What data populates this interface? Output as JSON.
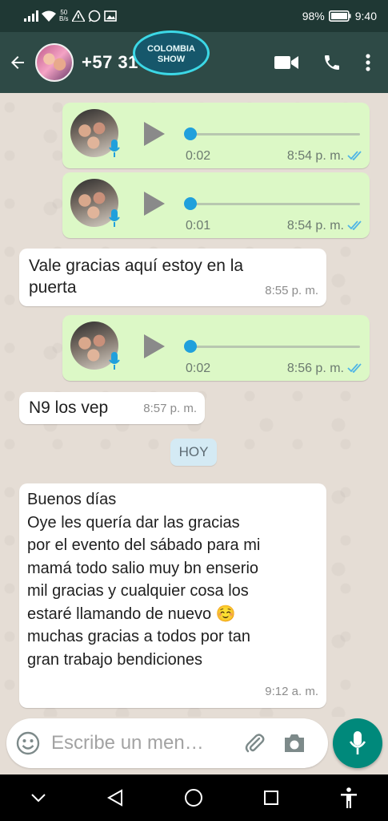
{
  "status_bar": {
    "net_speed_top": "50",
    "net_speed_bottom": "B/s",
    "battery": "98%",
    "time": "9:40"
  },
  "header": {
    "contact_name": "+57 31 55",
    "watermark": {
      "line1": "COLOMBIA",
      "line2": "SHOW"
    }
  },
  "messages": [
    {
      "type": "voice",
      "direction": "outgoing",
      "duration": "0:02",
      "time": "8:54 p. m.",
      "status": "read"
    },
    {
      "type": "voice",
      "direction": "outgoing",
      "duration": "0:01",
      "time": "8:54 p. m.",
      "status": "read"
    },
    {
      "type": "text",
      "direction": "incoming",
      "lines": [
        "Vale gracias aquí estoy en la",
        "puerta"
      ],
      "time": "8:55 p. m."
    },
    {
      "type": "voice",
      "direction": "outgoing",
      "duration": "0:02",
      "time": "8:56 p. m.",
      "status": "read"
    },
    {
      "type": "text",
      "direction": "incoming",
      "lines": [
        "N9 los vep"
      ],
      "time": "8:57 p. m."
    },
    {
      "type": "text",
      "direction": "incoming",
      "lines": [
        "Buenos días",
        "Oye les quería dar las gracias",
        "por el evento del sábado para mi",
        "mamá todo salio muy bn enserio",
        "mil gracias y cualquier cosa los",
        "estaré llamando de nuevo ☺️",
        "muchas gracias a todos por tan",
        "gran trabajo bendiciones"
      ],
      "time": "9:12 a. m."
    }
  ],
  "day_separator": "HOY",
  "composer": {
    "placeholder": "Escribe un men…"
  },
  "colors": {
    "header": "#2e4a46",
    "outgoing_bubble": "#dcf8c6",
    "incoming_bubble": "#ffffff",
    "accent": "#00897b",
    "read_ticks": "#4fb5e6"
  }
}
